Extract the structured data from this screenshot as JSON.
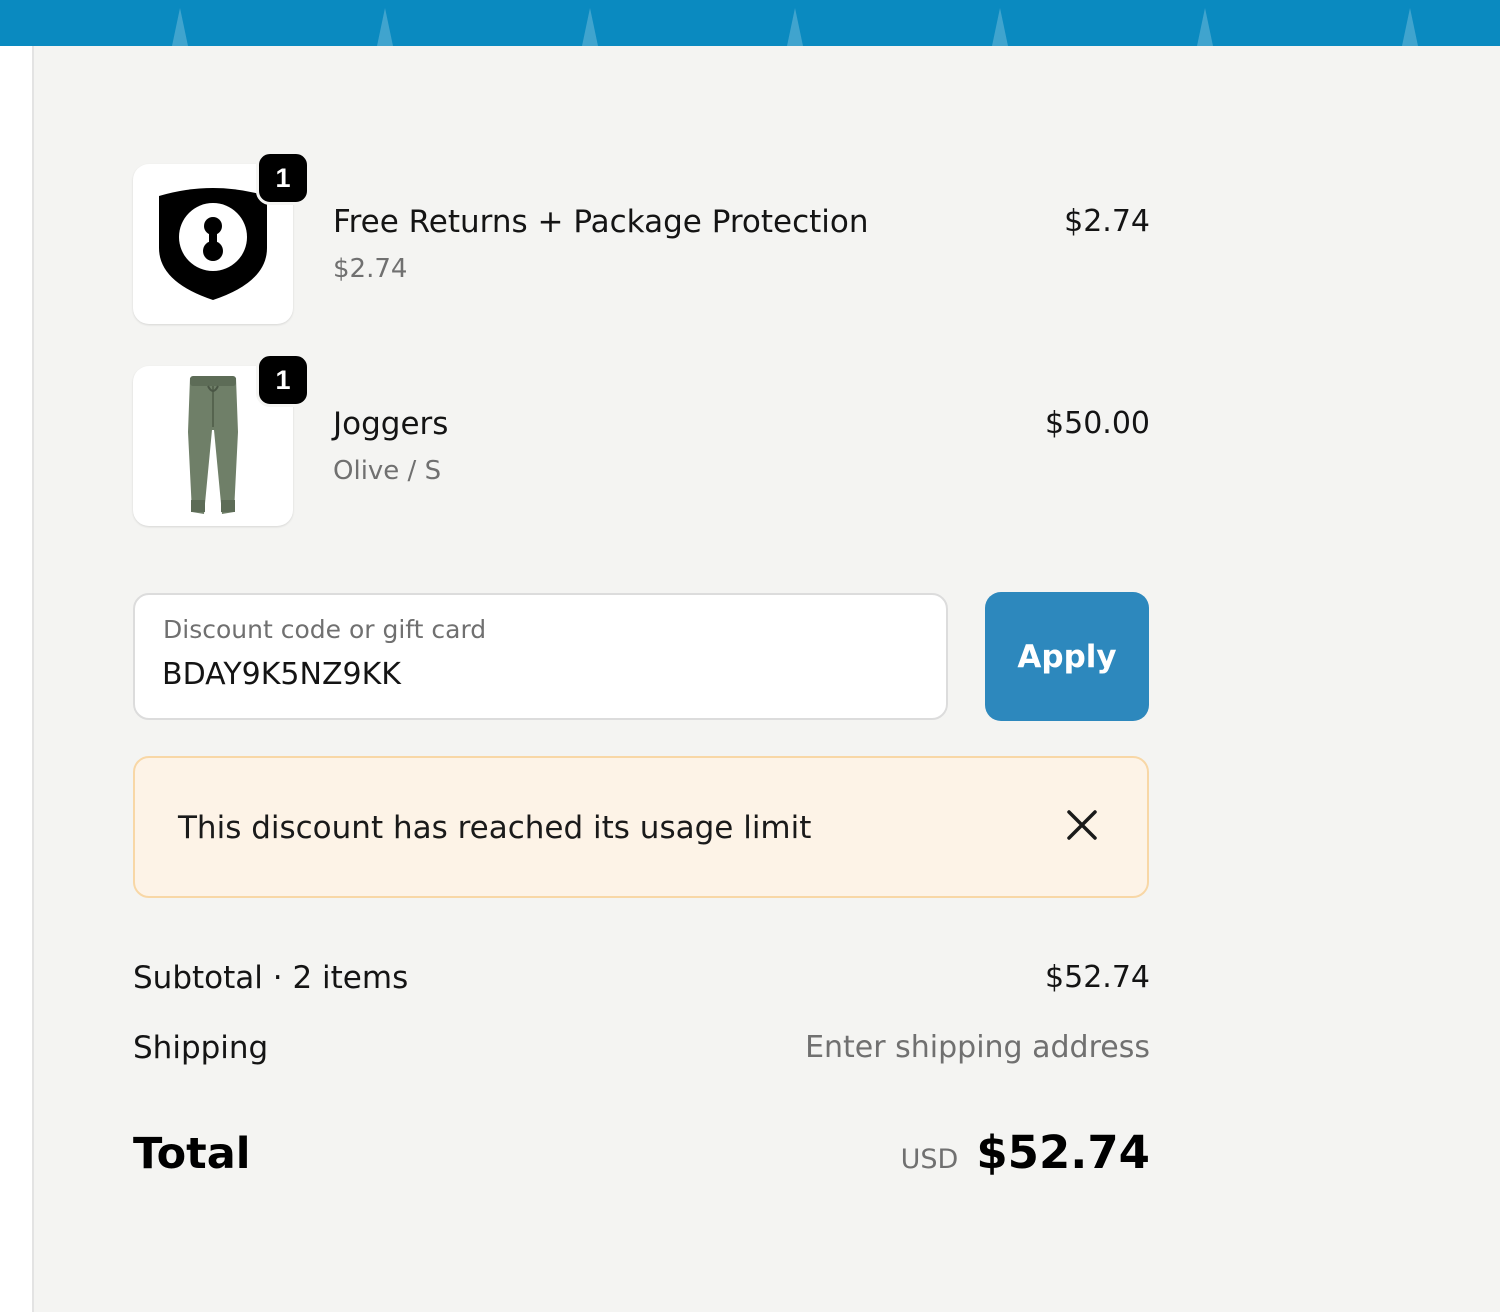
{
  "colors": {
    "header_bar": "#0a8ac0",
    "apply_button": "#2d88bd",
    "alert_background": "#fdf3e7",
    "alert_border": "#f8d7a6",
    "page_background": "#f4f4f2"
  },
  "line_items": [
    {
      "name": "Free Returns + Package Protection",
      "subtitle": "$2.74",
      "price": "$2.74",
      "quantity": "1",
      "icon": "shield-keyhole-icon"
    },
    {
      "name": "Joggers",
      "subtitle": "Olive / S",
      "price": "$50.00",
      "quantity": "1",
      "icon": "joggers-image"
    }
  ],
  "discount": {
    "label": "Discount code or gift card",
    "value": "BDAY9K5NZ9KK",
    "apply_label": "Apply"
  },
  "alert": {
    "message": "This discount has reached its usage limit",
    "close_icon": "close-icon"
  },
  "totals": {
    "subtotal_label": "Subtotal · 2 items",
    "subtotal_value": "$52.74",
    "shipping_label": "Shipping",
    "shipping_value": "Enter shipping address",
    "total_label": "Total",
    "currency": "USD",
    "total_value": "$52.74"
  }
}
